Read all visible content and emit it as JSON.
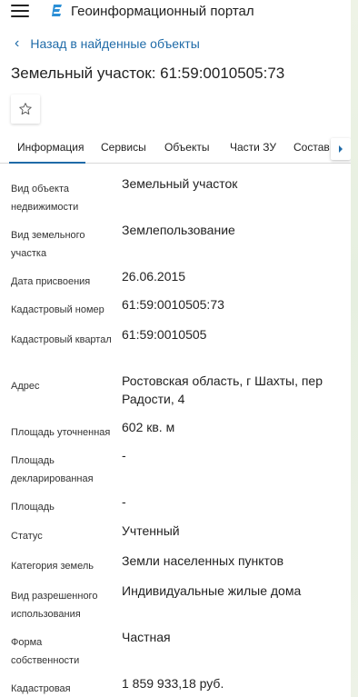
{
  "header": {
    "app_title": "Геоинформационный портал"
  },
  "nav": {
    "back_label": "Назад в найденные объекты"
  },
  "object": {
    "title": "Земельный участок: 61:59:0010505:73"
  },
  "tabs": [
    {
      "label": "Информация",
      "active": true
    },
    {
      "label": "Сервисы",
      "active": false
    },
    {
      "label": "Объекты",
      "active": false
    },
    {
      "label": "Части ЗУ",
      "active": false
    },
    {
      "label": "Состав",
      "active": false
    }
  ],
  "fields": [
    {
      "label": "Вид объекта недвижимости",
      "value": "Земельный участок"
    },
    {
      "label": "Вид земельного участка",
      "value": "Землепользование"
    },
    {
      "label": "Дата присвоения",
      "value": "26.06.2015"
    },
    {
      "label": "Кадастровый номер",
      "value": "61:59:0010505:73"
    },
    {
      "label": "Кадастровый квартал",
      "value": "61:59:0010505"
    },
    {
      "label": "Адрес",
      "value": "Ростовская область, г Шахты, пер Радости, 4"
    },
    {
      "label": "Площадь уточненная",
      "value": "602 кв. м"
    },
    {
      "label": "Площадь декларированная",
      "value": "-"
    },
    {
      "label": "Площадь",
      "value": "-"
    },
    {
      "label": "Статус",
      "value": "Учтенный"
    },
    {
      "label": "Категория земель",
      "value": "Земли населенных пунктов"
    },
    {
      "label": "Вид разрешенного использования",
      "value": "Индивидуальные жилые дома"
    },
    {
      "label": "Форма собственности",
      "value": "Частная"
    },
    {
      "label": "Кадастровая",
      "value": "1 859 933,18 руб."
    }
  ],
  "colors": {
    "accent": "#1f6ba8",
    "map_background": "#e9efe4"
  },
  "icons": {
    "menu": "hamburger-icon",
    "logo": "portal-logo-icon",
    "back": "chevron-left-icon",
    "favorite": "star-icon",
    "tabs_next": "chevron-right-icon"
  }
}
